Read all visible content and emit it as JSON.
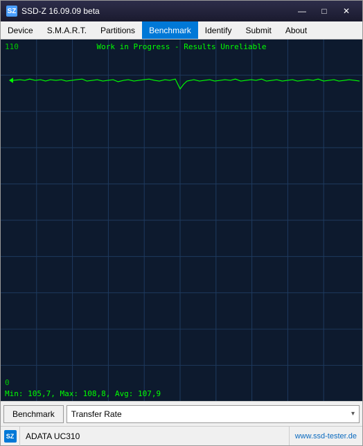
{
  "window": {
    "title": "SSD-Z 16.09.09 beta",
    "icon": "SZ"
  },
  "titlebar": {
    "minimize": "—",
    "maximize": "□",
    "close": "✕"
  },
  "menu": {
    "items": [
      {
        "label": "Device",
        "active": false
      },
      {
        "label": "S.M.A.R.T.",
        "active": false
      },
      {
        "label": "Partitions",
        "active": false
      },
      {
        "label": "Benchmark",
        "active": true
      },
      {
        "label": "Identify",
        "active": false
      },
      {
        "label": "Submit",
        "active": false
      },
      {
        "label": "About",
        "active": false
      }
    ]
  },
  "chart": {
    "title": "Work in Progress - Results Unreliable",
    "y_max": "110",
    "y_min": "0",
    "stats": "Min: 105,7, Max: 108,8, Avg: 107,9",
    "grid_color": "#1e3a5f",
    "line_color": "#00ff00",
    "bg_color": "#0d1a2e"
  },
  "toolbar": {
    "benchmark_label": "Benchmark",
    "dropdown_label": "Transfer Rate",
    "dropdown_arrow": "▾"
  },
  "statusbar": {
    "device": "ADATA UC310",
    "website": "www.ssd-tester.de"
  }
}
